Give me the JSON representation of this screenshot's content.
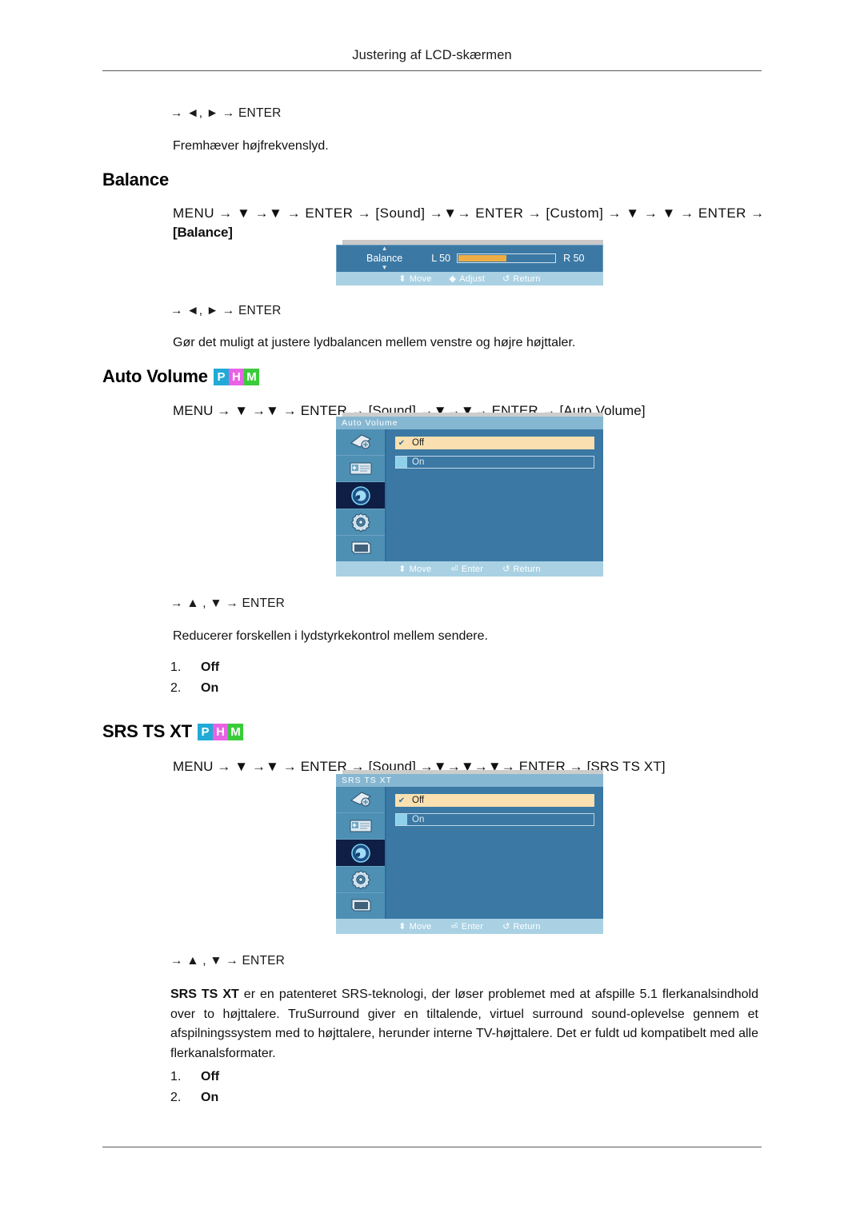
{
  "page": {
    "running_head": "Justering af LCD-skærmen"
  },
  "treble_tail": {
    "keys": "→ ◄, ► → ENTER",
    "description": "Fremhæver højfrekvenslyd."
  },
  "balance": {
    "title": "Balance",
    "menu_path_line1": "MENU → ▼ →▼ → ENTER → [Sound] →▼→ ENTER → [Custom] → ▼ → ▼ → ENTER →",
    "menu_path_line2": "[Balance]",
    "tokens": {
      "menu": "MENU",
      "enter": "ENTER",
      "sound": "Sound",
      "custom": "Custom",
      "balance": "Balance"
    },
    "keys": "→ ◄, ► → ENTER",
    "description": "Gør det muligt at justere lydbalancen mellem venstre og højre højttaler.",
    "osd": {
      "label": "Balance",
      "left_label": "L",
      "left_value": "50",
      "right_label": "R",
      "right_value": "50",
      "fill_percent": 50,
      "footer": [
        {
          "glyph": "⬍",
          "label": "Move"
        },
        {
          "glyph": "◆",
          "label": "Adjust"
        },
        {
          "glyph": "↺",
          "label": "Return"
        }
      ]
    }
  },
  "auto_volume": {
    "title": "Auto Volume",
    "badges": [
      "P",
      "H",
      "M"
    ],
    "menu_path": "MENU → ▼ →▼ → ENTER → [Sound] →▼→▼→ ENTER → [Auto Volume]",
    "keys": "→ ▲ , ▼ → ENTER",
    "description": "Reducerer forskellen i lydstyrkekontrol mellem sendere.",
    "options": [
      {
        "num": "1.",
        "label": "Off"
      },
      {
        "num": "2.",
        "label": "On"
      }
    ],
    "osd": {
      "title": "Auto Volume",
      "items": [
        {
          "label": "Off",
          "state": "selected"
        },
        {
          "label": "On",
          "state": "unselected"
        }
      ],
      "footer": [
        {
          "glyph": "⬍",
          "label": "Move"
        },
        {
          "glyph": "⏎",
          "label": "Enter"
        },
        {
          "glyph": "↺",
          "label": "Return"
        }
      ],
      "sidebar_icons": [
        "picture-icon",
        "image-card-icon",
        "sound-icon",
        "setup-gear-icon",
        "multi-control-monitor-icon"
      ],
      "active_icon_index": 2
    }
  },
  "srs_ts_xt": {
    "title": "SRS TS XT",
    "badges": [
      "P",
      "H",
      "M"
    ],
    "menu_path": "MENU → ▼ →▼ → ENTER → [Sound] →▼→▼→▼→ ENTER → [SRS TS XT]",
    "keys": "→ ▲ , ▼ → ENTER",
    "description_lead": "SRS TS XT",
    "description_rest": " er en patenteret SRS-teknologi, der løser problemet med at afspille 5.1 flerkanalsindhold over to højttalere. TruSurround giver en tiltalende, virtuel surround sound-oplevelse gennem et afspilningssystem med to højttalere, herunder interne TV-højttalere. Det er fuldt ud kompatibelt med alle flerkanalsformater.",
    "options": [
      {
        "num": "1.",
        "label": "Off"
      },
      {
        "num": "2.",
        "label": "On"
      }
    ],
    "osd": {
      "title": "SRS TS XT",
      "items": [
        {
          "label": "Off",
          "state": "selected"
        },
        {
          "label": "On",
          "state": "unselected"
        }
      ],
      "footer": [
        {
          "glyph": "⬍",
          "label": "Move"
        },
        {
          "glyph": "⏎",
          "label": "Enter"
        },
        {
          "glyph": "↺",
          "label": "Return"
        }
      ],
      "sidebar_icons": [
        "picture-icon",
        "image-card-icon",
        "sound-icon",
        "setup-gear-icon",
        "multi-control-monitor-icon"
      ],
      "active_icon_index": 2
    }
  },
  "colors": {
    "osd_background": "#3B78A4",
    "osd_titlebar": "#86B7D2",
    "osd_sidebar": "#4E8FB4",
    "osd_active_icon": "#0E1E44",
    "osd_footer": "#A9D1E3",
    "option_selected": "#FAE0B0",
    "slider_fill": "#EDAE45",
    "badge_p": "#21AAD6",
    "badge_h": "#E862E6",
    "badge_m": "#3ACB3A"
  }
}
